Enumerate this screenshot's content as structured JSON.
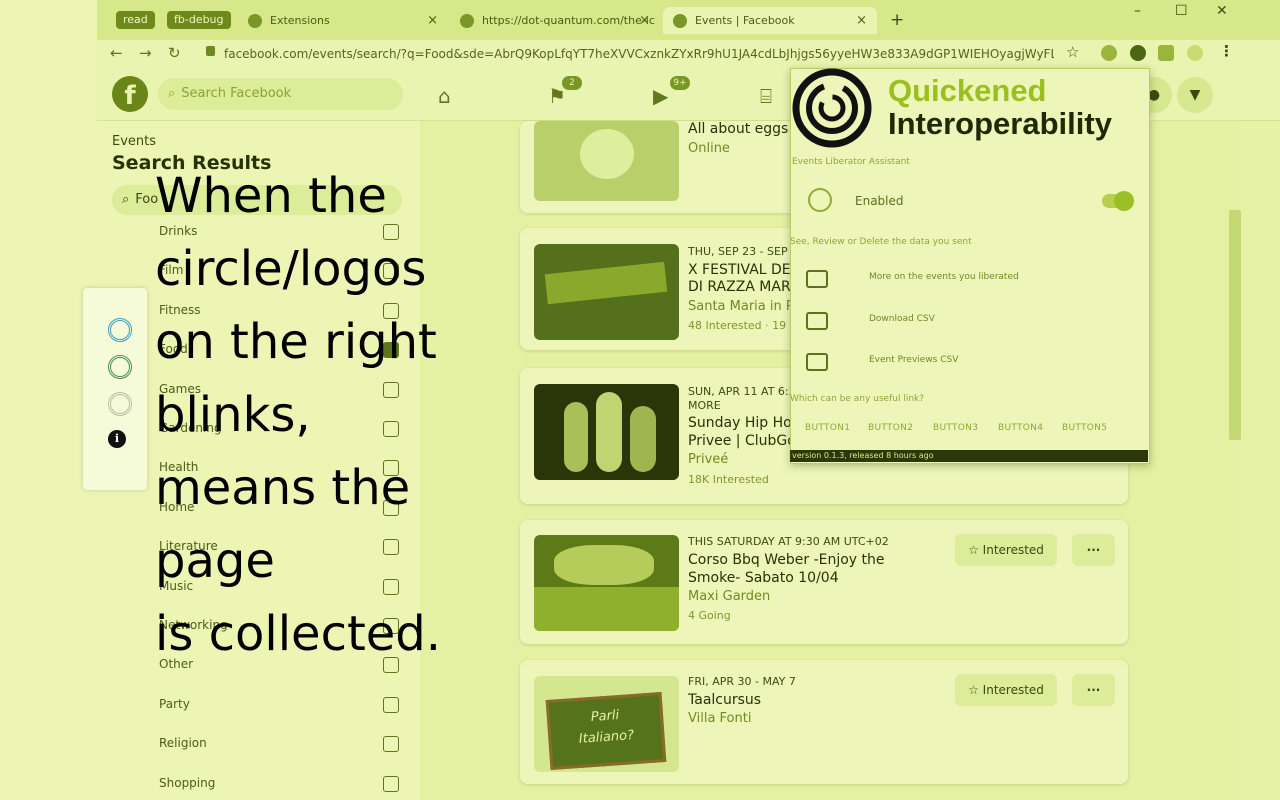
{
  "browser": {
    "pills": [
      "read",
      "fb-debug"
    ],
    "tabs": [
      {
        "label": "Extensions",
        "close": "×"
      },
      {
        "label": "https://dot-quantum.com/the-ic",
        "close": "×"
      },
      {
        "label": "Events | Facebook",
        "close": "×"
      }
    ],
    "new_tab": "+",
    "window_controls": [
      "–",
      "☐",
      "✕"
    ],
    "nav": {
      "back": "←",
      "forward": "→",
      "reload": "↻"
    },
    "url": "facebook.com/events/search/?q=Food&sde=AbrQ9KopLfqYT7heXVVCxznkZYxRr9hU1JA4cdLbJhjgs56yyeHW3e833A9dGP1WIEHOyagjWyFL9Y79gw...",
    "icons": [
      "lock-icon",
      "star-icon",
      "extension-icon",
      "puzzle-icon",
      "menu-kebab-icon"
    ]
  },
  "facebook": {
    "logo": "f",
    "search_placeholder": "Search Facebook",
    "search_icon": "⌕",
    "nav_icons": [
      "⌂",
      "⚑",
      "▶",
      "⌸"
    ],
    "badges": [
      "2",
      "9+"
    ],
    "header_right": [
      "●",
      "▼"
    ]
  },
  "filters": {
    "breadcrumb": "Events",
    "title": "Search Results",
    "search_value": "Foo",
    "categories": [
      {
        "label": "Drinks",
        "checked": false
      },
      {
        "label": "Film",
        "checked": false
      },
      {
        "label": "Fitness",
        "checked": false
      },
      {
        "label": "Food",
        "checked": true
      },
      {
        "label": "Games",
        "checked": false
      },
      {
        "label": "Gardening",
        "checked": false
      },
      {
        "label": "Health",
        "checked": false
      },
      {
        "label": "Home",
        "checked": false
      },
      {
        "label": "Literature",
        "checked": false
      },
      {
        "label": "Music",
        "checked": false
      },
      {
        "label": "Networking",
        "checked": false
      },
      {
        "label": "Other",
        "checked": false
      },
      {
        "label": "Party",
        "checked": false
      },
      {
        "label": "Religion",
        "checked": false
      },
      {
        "label": "Shopping",
        "checked": false
      }
    ]
  },
  "events": [
    {
      "date": "",
      "title": "All about eggs",
      "place": "Online",
      "meta": ""
    },
    {
      "date": "THU, SEP 23 - SEP 2",
      "title": "X FESTIVAL DEL",
      "title2": "DI RAZZA MAR",
      "place": "Santa Maria in Pi",
      "meta": "48 Interested · 19 G"
    },
    {
      "date": "SUN, APR 11 AT 6:30",
      "date2": "MORE",
      "title": "Sunday Hip Ho",
      "title2": "Privee | ClubGo",
      "place": "Priveé",
      "meta": "18K Interested"
    },
    {
      "date": "THIS SATURDAY AT 9:30 AM UTC+02",
      "title": "Corso Bbq Weber -Enjoy the",
      "title2": "Smoke- Sabato 10/04",
      "place": "Maxi Garden",
      "meta": "4 Going",
      "interested": "Interested",
      "more": "···"
    },
    {
      "date": "FRI, APR 30 - MAY 7",
      "title": "Taalcursus",
      "place": "Villa Fonti",
      "meta": "",
      "interested": "Interested",
      "more": "···",
      "thumb_text": [
        "Parli",
        "Italiano?"
      ]
    }
  ],
  "popup": {
    "brand_line1": "Quickened",
    "brand_line2": "Interoperability",
    "subtitle": "Events Liberator Assistant",
    "enabled_label": "Enabled",
    "hint": "See, Review or Delete the data you sent",
    "rows": [
      "More on the events you liberated",
      "Download CSV",
      "Event Previews CSV"
    ],
    "question": "Which can be any useful link?",
    "buttons": [
      "BUTTON1",
      "BUTTON2",
      "BUTTON3",
      "BUTTON4",
      "BUTTON5"
    ],
    "version": "version 0.1.3, released 8 hours ago"
  },
  "overlay_caption": "When the\ncircle/logos\non the right\nblinks,\nmeans the\npage\nis collected.",
  "colors": {
    "tint": "#e6f2a6",
    "accent": "#6a8618",
    "dark": "#1f2a05",
    "brand_green": "#9bbf22"
  }
}
